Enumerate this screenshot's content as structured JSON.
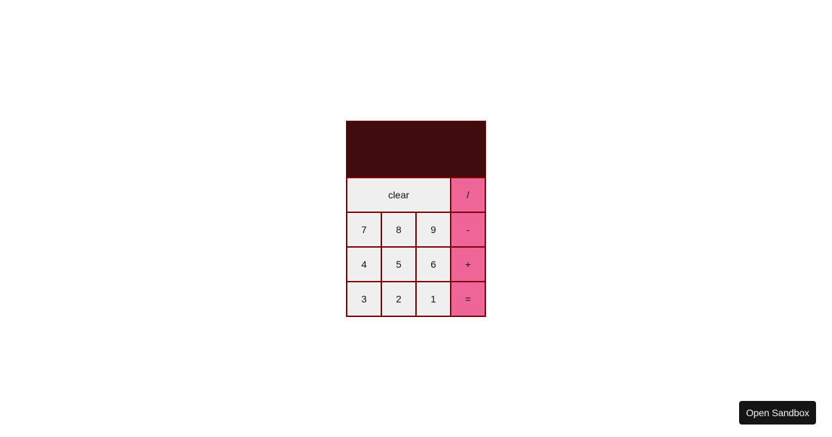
{
  "calculator": {
    "display_value": "",
    "rows": [
      [
        {
          "label": "clear",
          "type": "clear"
        },
        {
          "label": "/",
          "type": "op"
        }
      ],
      [
        {
          "label": "7",
          "type": "num"
        },
        {
          "label": "8",
          "type": "num"
        },
        {
          "label": "9",
          "type": "num"
        },
        {
          "label": "-",
          "type": "op"
        }
      ],
      [
        {
          "label": "4",
          "type": "num"
        },
        {
          "label": "5",
          "type": "num"
        },
        {
          "label": "6",
          "type": "num"
        },
        {
          "label": "+",
          "type": "op"
        }
      ],
      [
        {
          "label": "3",
          "type": "num"
        },
        {
          "label": "2",
          "type": "num"
        },
        {
          "label": "1",
          "type": "num"
        },
        {
          "label": "=",
          "type": "op"
        }
      ]
    ]
  },
  "colors": {
    "display_bg": "#410c0d",
    "border": "#7f0000",
    "key_bg": "#efefef",
    "operator_bg": "#ee6597"
  },
  "footer": {
    "open_sandbox_label": "Open Sandbox"
  }
}
